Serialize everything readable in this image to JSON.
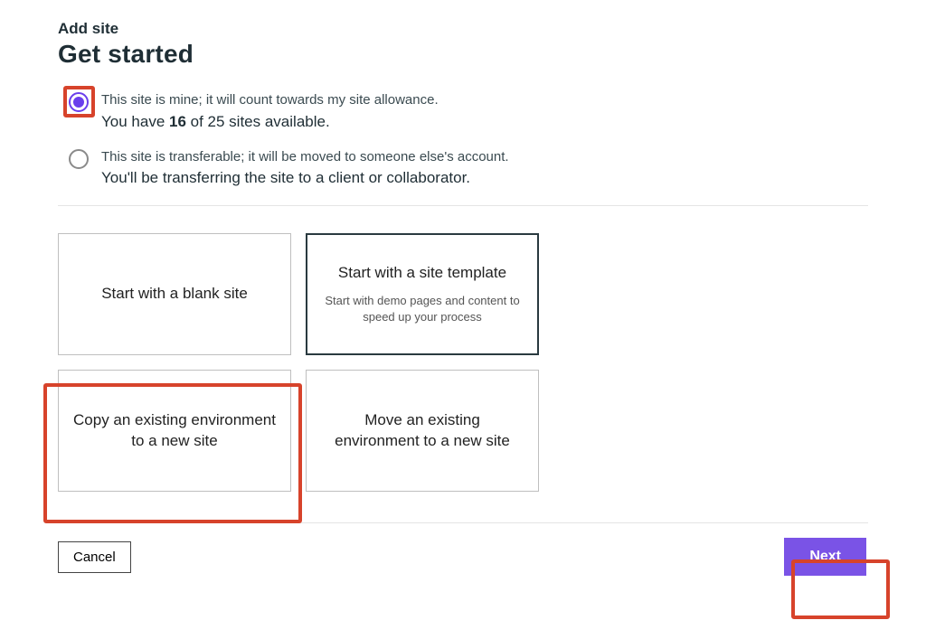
{
  "header": {
    "pre_title": "Add site",
    "title": "Get started"
  },
  "ownership": {
    "options": [
      {
        "primary": "This site is mine; it will count towards my site allowance.",
        "secondary_pre": "You have ",
        "secondary_bold": "16",
        "secondary_post": " of 25 sites available.",
        "selected": true
      },
      {
        "primary": "This site is transferable; it will be moved to someone else's account.",
        "secondary": "You'll be transferring the site to a client or collaborator.",
        "selected": false
      }
    ]
  },
  "start_options": [
    {
      "title": "Start with a blank site",
      "subtitle": ""
    },
    {
      "title": "Start with a site template",
      "subtitle": "Start with demo pages and content to speed up your process"
    },
    {
      "title": "Copy an existing environment to a new site",
      "subtitle": ""
    },
    {
      "title": "Move an existing environment to a new site",
      "subtitle": ""
    }
  ],
  "footer": {
    "cancel": "Cancel",
    "next": "Next"
  },
  "colors": {
    "accent": "#7a53e6",
    "highlight": "#d7432b"
  }
}
